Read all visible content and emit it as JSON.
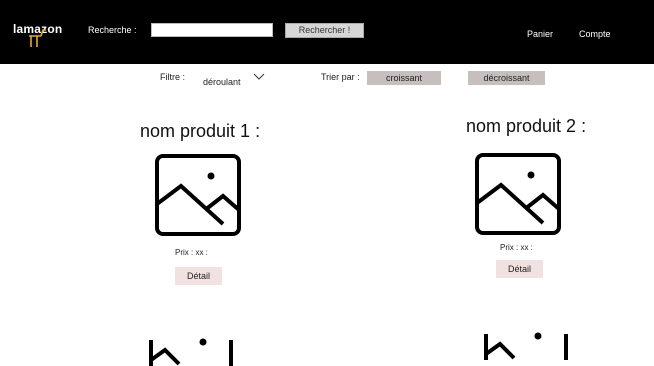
{
  "header": {
    "logo_text": "lamazon",
    "search_label": "Recherche :",
    "search_value": "",
    "search_placeholder": "",
    "search_button": "Rechercher !",
    "cart": "Panier",
    "account": "Compte"
  },
  "filters": {
    "filter_label": "Filtre :",
    "filter_value": "déroulant",
    "sort_label": "Trier par :",
    "sort_asc": "croissant",
    "sort_desc": "décroissant"
  },
  "products": [
    {
      "name": "nom produit 1 :",
      "price": "Prix : xx :",
      "detail": "Détail"
    },
    {
      "name": "nom produit 2 :",
      "price": "Prix : xx :",
      "detail": "Détail"
    }
  ],
  "colors": {
    "header_bg": "#000000",
    "sort_button_bg": "#c7bebe",
    "detail_button_bg": "#f1e1e1"
  }
}
